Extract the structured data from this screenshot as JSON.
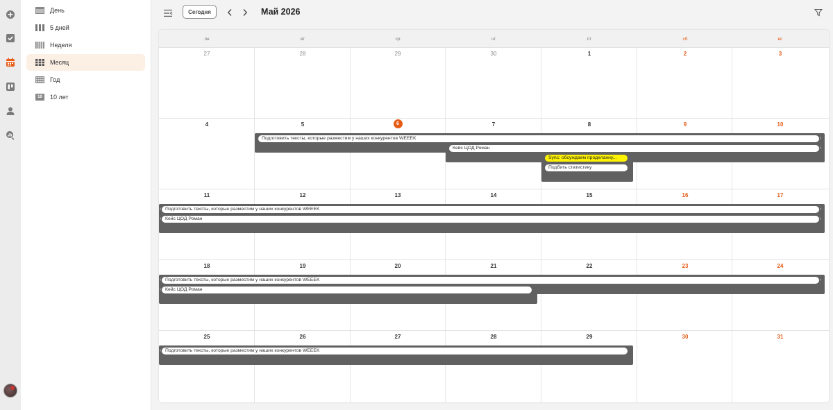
{
  "nav_rail": {
    "icons": [
      "plus-circle-icon",
      "checkbox-icon",
      "calendar-icon",
      "board-icon",
      "user-icon",
      "search-analytics-icon"
    ],
    "active": "calendar-icon",
    "accent": "#e65b16"
  },
  "views": {
    "items": [
      {
        "label": "День",
        "icon": "day-view-icon"
      },
      {
        "label": "5 дней",
        "icon": "five-days-view-icon"
      },
      {
        "label": "Неделя",
        "icon": "week-view-icon"
      },
      {
        "label": "Месяц",
        "icon": "month-view-icon",
        "active": true
      },
      {
        "label": "Год",
        "icon": "year-view-icon"
      },
      {
        "label": "10 лет",
        "icon": "ten-years-view-icon",
        "badge": "10"
      }
    ]
  },
  "toolbar": {
    "today_label": "Сегодня",
    "month_title": "Май 2026"
  },
  "calendar": {
    "weekdays": [
      "пн",
      "вт",
      "ср",
      "чт",
      "пт",
      "сб",
      "вс"
    ],
    "weeks": [
      {
        "days": [
          "27",
          "28",
          "29",
          "30",
          "1",
          "2",
          "3"
        ]
      },
      {
        "days": [
          "4",
          "5",
          "6",
          "7",
          "8",
          "9",
          "10"
        ]
      },
      {
        "days": [
          "11",
          "12",
          "13",
          "14",
          "15",
          "16",
          "17"
        ]
      },
      {
        "days": [
          "18",
          "19",
          "20",
          "21",
          "22",
          "23",
          "24"
        ]
      },
      {
        "days": [
          "25",
          "26",
          "27",
          "28",
          "29",
          "30",
          "31"
        ]
      }
    ],
    "today": "6",
    "events": {
      "texts": "Подготовить тексты, которые разместим у наших конкурентов WEEEK",
      "case": "Кейс ЦОД Роман",
      "sync": "Sync: обсуждаем проделанну...",
      "stats": "Подбить статистику"
    },
    "colors": {
      "event_band": "#616161",
      "sync_event": "#fff300",
      "weekend": "#e65b16"
    }
  }
}
